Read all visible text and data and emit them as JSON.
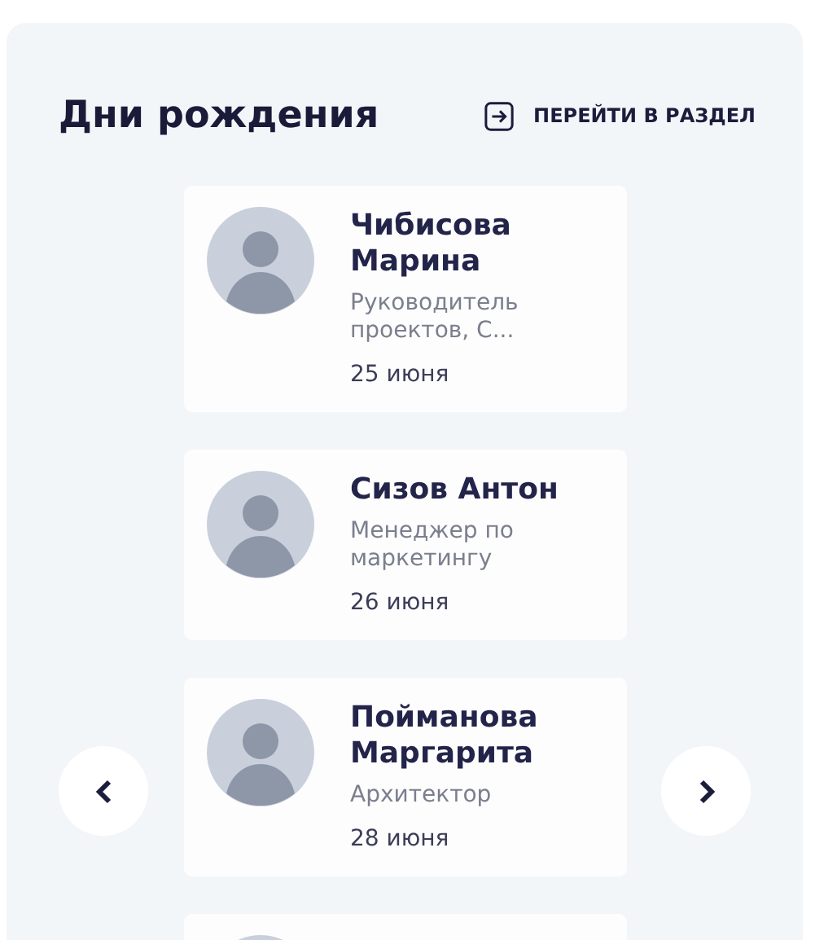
{
  "widget": {
    "title": "Дни рождения",
    "link": "ПЕРЕЙТИ В РАЗДЕЛ"
  },
  "people": [
    {
      "kind": "person",
      "name": "Чибисова Марина",
      "role": "Руководитель проектов, С...",
      "date": "25 июня"
    },
    {
      "kind": "person",
      "name": "Сизов Антон",
      "role": "Менеджер по маркетингу",
      "date": "26 июня"
    },
    {
      "kind": "person",
      "name": "Пойманова Маргарита",
      "role": "Архитектор",
      "date": "28 июня"
    },
    {
      "kind": "person"
    }
  ]
}
